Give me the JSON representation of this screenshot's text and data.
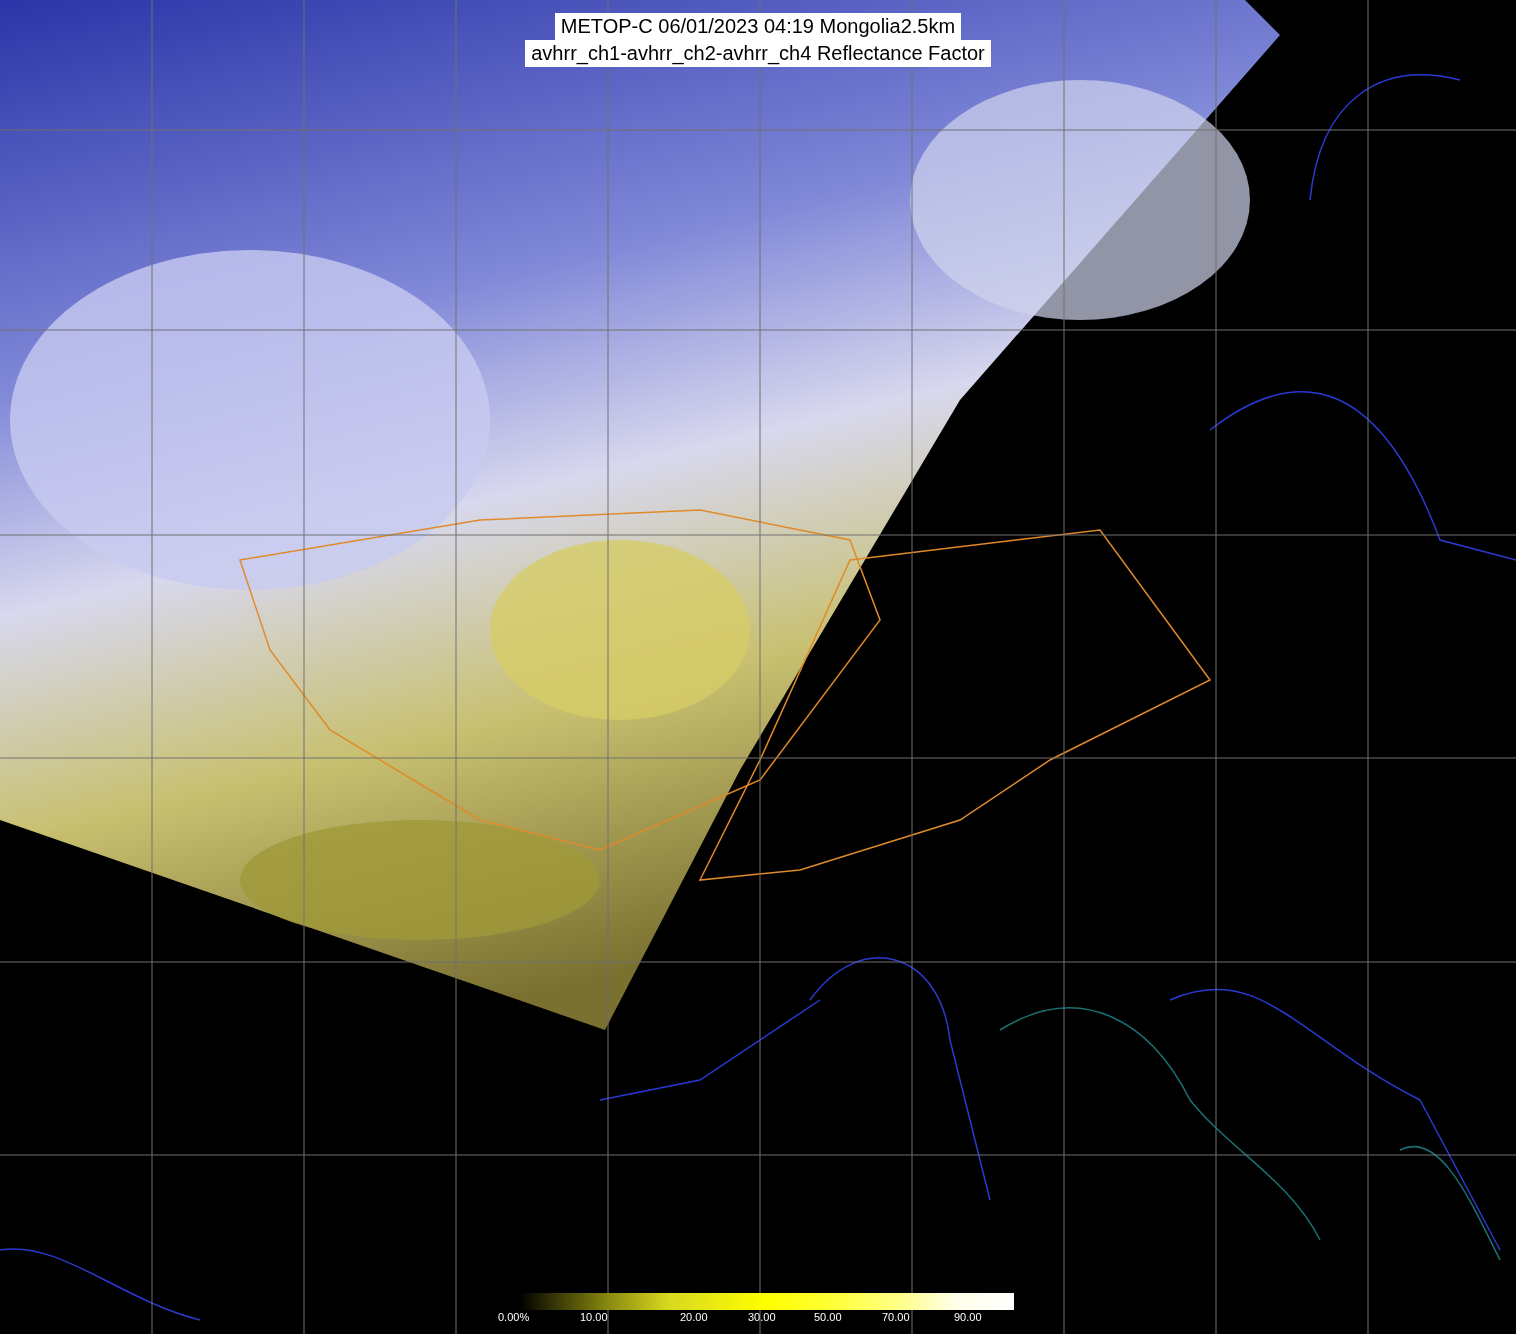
{
  "title": {
    "lines": [
      "METOP-C 06/01/2023 04:19 Mongolia2.5km",
      "avhrr_ch1-avhrr_ch2-avhrr_ch4 Reflectance Factor"
    ]
  },
  "colorbar": {
    "labels": [
      "0.00%",
      "10.00",
      "20.00",
      "30.00",
      "50.00",
      "70.00",
      "90.00"
    ]
  }
}
